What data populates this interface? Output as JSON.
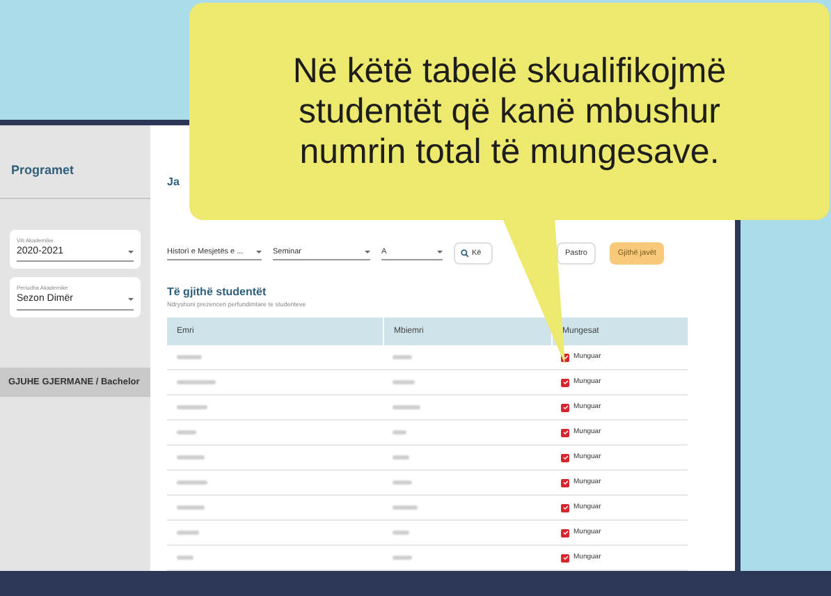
{
  "callout": {
    "text": "Në këtë tabelë skualifikojmë studentët që kanë mbushur numrin total të mungesave."
  },
  "sidebar": {
    "title": "Programet",
    "fields": [
      {
        "label": "Viti Akademike",
        "value": "2020-2021"
      },
      {
        "label": "Periudha Akademike",
        "value": "Sezon Dimër"
      }
    ],
    "program": "GJUHE GJERMANE / Bachelor"
  },
  "main": {
    "heading": "Ja",
    "filters": [
      {
        "value": "Historì e Mesjetës e ..."
      },
      {
        "value": "Seminar"
      },
      {
        "value": "A"
      }
    ],
    "buttons": [
      {
        "kind": "search",
        "label": "Kë"
      },
      {
        "kind": "plain",
        "label": "Pastro"
      },
      {
        "kind": "primary",
        "label": "Gjithë javët"
      }
    ],
    "section_title": "Të gjithë studentët",
    "section_subtitle": "Ndryshoni prezencen perfundimtare te studenteve",
    "table": {
      "columns": [
        "Emri",
        "Mbiemri",
        "Mungesat"
      ],
      "rows": [
        {
          "checked": true,
          "status": "Munguar"
        },
        {
          "checked": true,
          "status": "Munguar"
        },
        {
          "checked": true,
          "status": "Munguar"
        },
        {
          "checked": true,
          "status": "Munguar"
        },
        {
          "checked": true,
          "status": "Munguar"
        },
        {
          "checked": true,
          "status": "Munguar"
        },
        {
          "checked": true,
          "status": "Munguar"
        },
        {
          "checked": true,
          "status": "Munguar"
        },
        {
          "checked": true,
          "status": "Munguar"
        }
      ]
    }
  }
}
